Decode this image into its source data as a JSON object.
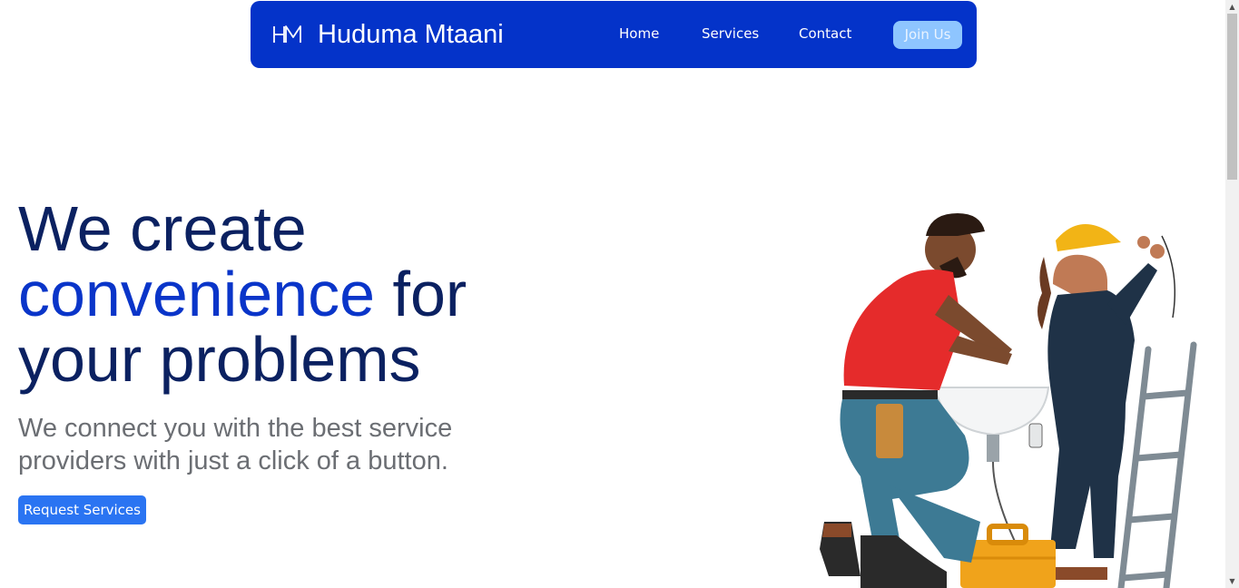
{
  "header": {
    "logo_icon": "hm-monogram-icon",
    "brand": "Huduma Mtaani",
    "nav": [
      {
        "label": "Home"
      },
      {
        "label": "Services"
      },
      {
        "label": "Contact"
      }
    ],
    "join_label": "Join Us"
  },
  "hero": {
    "title_line1": "We create",
    "title_accent": "convenience",
    "title_rest1": " for",
    "title_line3": "your problems",
    "subtitle": "We connect you with the best service providers with just a click of a button.",
    "cta_label": "Request Services",
    "illustration": "plumber-and-electrician-illustration"
  },
  "colors": {
    "navbar": "#0433c9",
    "heading": "#0b2161",
    "accent": "#0a35c9",
    "cta": "#2a74f2",
    "join_button": "#8ec5ff"
  }
}
